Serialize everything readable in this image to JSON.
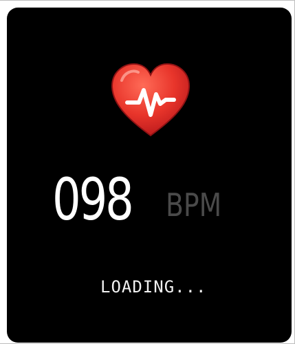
{
  "heart_rate": {
    "value": "098",
    "unit": "BPM",
    "status": "LOADING...",
    "icon": "heart-pulse-icon"
  },
  "colors": {
    "background": "#000000",
    "heart": "#e8352b",
    "value": "#ffffff",
    "unit": "#4a4a4a"
  }
}
